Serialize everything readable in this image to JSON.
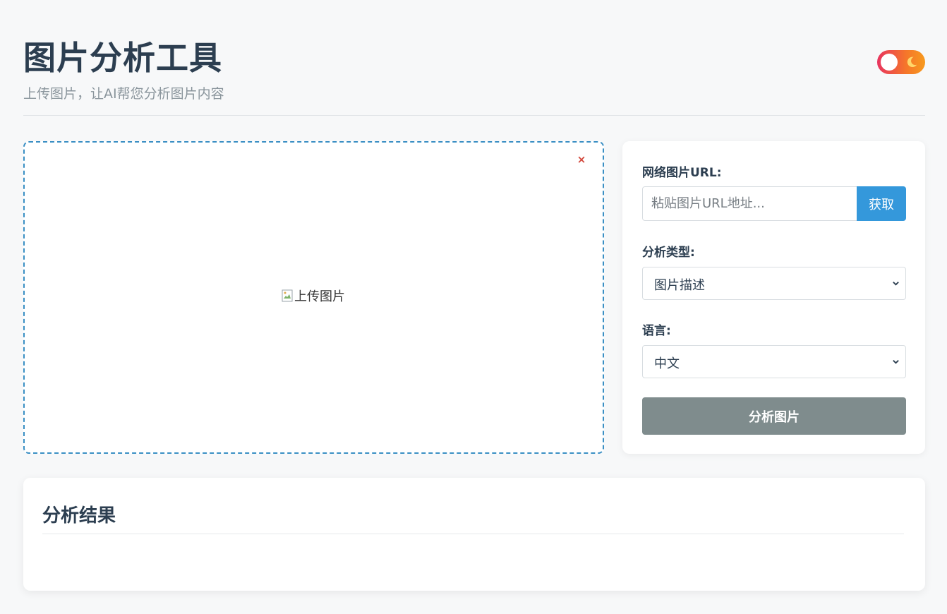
{
  "header": {
    "title": "图片分析工具",
    "subtitle": "上传图片，让AI帮您分析图片内容",
    "theme_toggle_icon": "moon-icon"
  },
  "upload": {
    "remove_label": "×",
    "image_alt": "上传图片",
    "border_color": "#3a8fc4"
  },
  "panel": {
    "url_label": "网络图片URL:",
    "url_placeholder": "粘贴图片URL地址...",
    "url_value": "",
    "fetch_label": "获取",
    "type_label": "分析类型:",
    "type_selected": "图片描述",
    "language_label": "语言:",
    "language_selected": "中文",
    "analyze_label": "分析图片"
  },
  "results": {
    "title": "分析结果",
    "content": ""
  },
  "colors": {
    "accent": "#3498db",
    "disabled_button": "#7f8c8d",
    "text": "#2c3e50",
    "danger": "#d2463a"
  }
}
